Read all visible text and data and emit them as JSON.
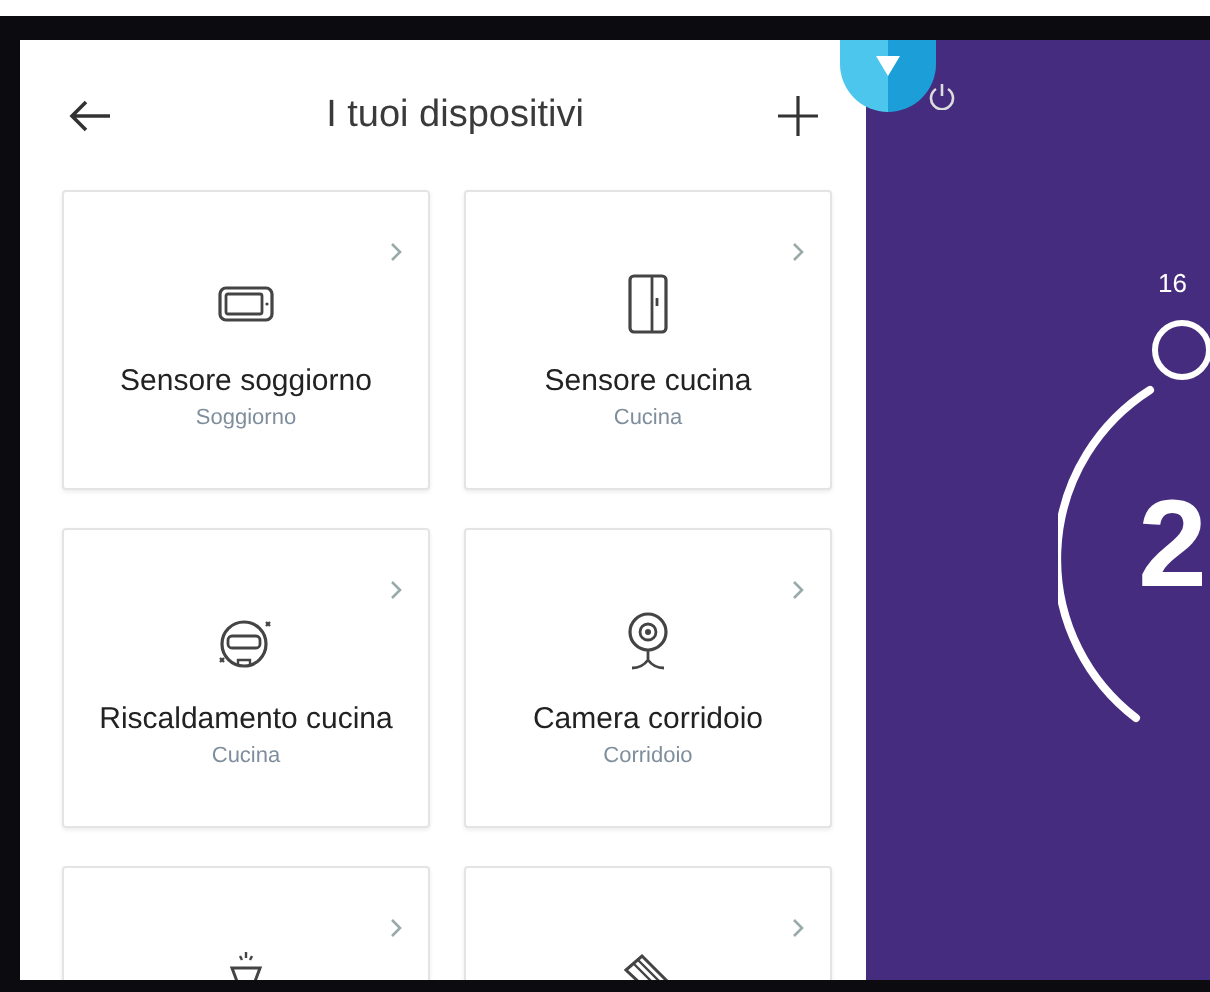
{
  "header": {
    "title": "I tuoi dispositivi"
  },
  "devices": [
    {
      "kind": "display",
      "name": "Sensore soggiorno",
      "room": "Soggiorno"
    },
    {
      "kind": "door",
      "name": "Sensore cucina",
      "room": "Cucina"
    },
    {
      "kind": "robot",
      "name": "Riscaldamento cucina",
      "room": "Cucina"
    },
    {
      "kind": "camera",
      "name": "Camera corridoio",
      "room": "Corridoio"
    },
    {
      "kind": "lamp"
    },
    {
      "kind": "can"
    }
  ],
  "thermostat": {
    "min_label": "16",
    "temperature": "2"
  }
}
